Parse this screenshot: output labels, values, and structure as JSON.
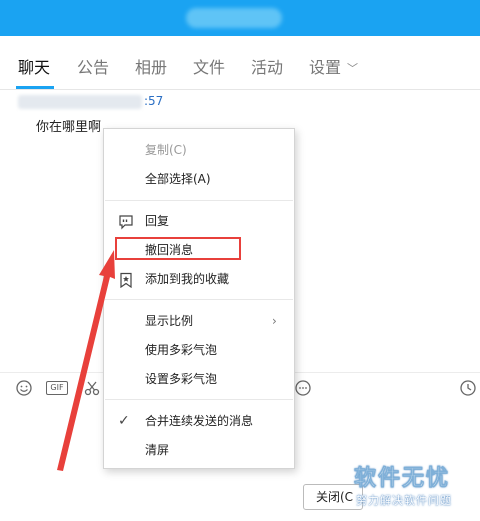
{
  "tabs": [
    {
      "label": "聊天",
      "active": true
    },
    {
      "label": "公告"
    },
    {
      "label": "相册"
    },
    {
      "label": "文件"
    },
    {
      "label": "活动"
    },
    {
      "label": "设置"
    }
  ],
  "chat": {
    "sender_time": ":57",
    "message": "你在哪里啊"
  },
  "context_menu": {
    "copy": "复制(C)",
    "select_all": "全部选择(A)",
    "reply": "回复",
    "recall": "撤回消息",
    "add_favorite": "添加到我的收藏",
    "display_ratio": "显示比例",
    "use_bubble": "使用多彩气泡",
    "set_bubble": "设置多彩气泡",
    "merge_messages": "合并连续发送的消息",
    "clear_screen": "清屏"
  },
  "toolbar": {
    "gif_label": "GIF"
  },
  "input": {
    "close_label": "关闭(C"
  },
  "watermark": {
    "main": "软件无忧",
    "sub": "努力解决软件问题"
  },
  "colors": {
    "accent": "#1aa3f2",
    "highlight": "#e8403b",
    "link": "#2b6fc4"
  }
}
